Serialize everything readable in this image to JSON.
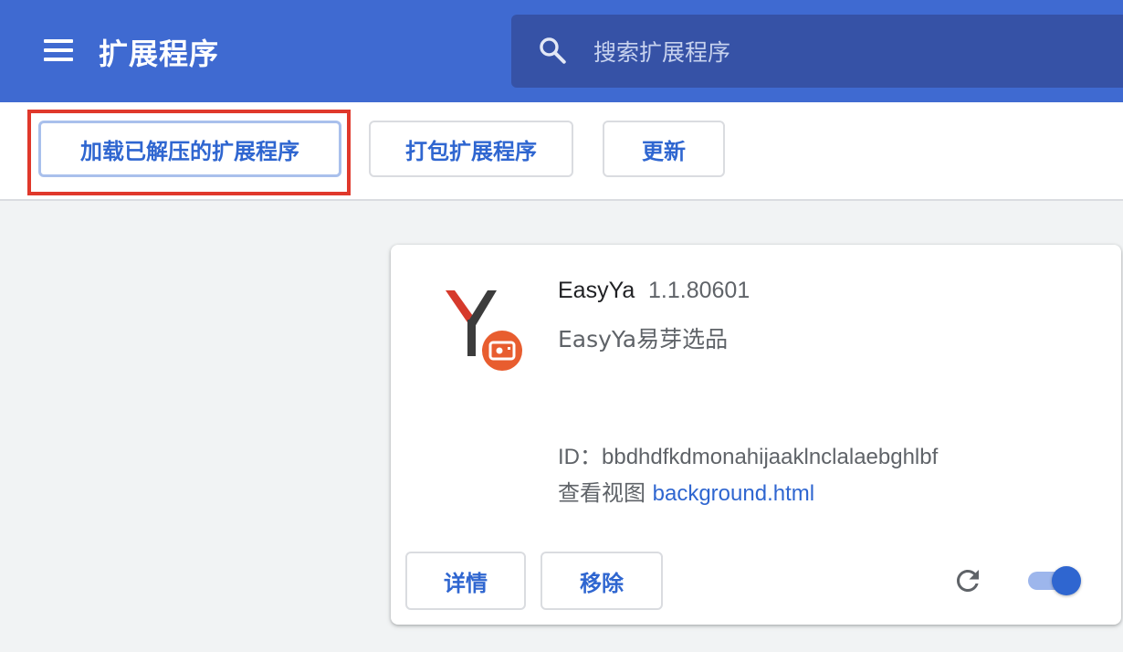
{
  "header": {
    "title": "扩展程序",
    "search_placeholder": "搜索扩展程序"
  },
  "toolbar": {
    "load_unpacked_label": "加载已解压的扩展程序",
    "pack_label": "打包扩展程序",
    "update_label": "更新"
  },
  "extension": {
    "name": "EasyYa",
    "version": "1.1.80601",
    "description": "EasyYa易芽选品",
    "id_label": "ID：",
    "id_value": "bbdhdfkdmonahijaaklnclalaebghlbf",
    "view_label": "查看视图",
    "view_link": "background.html",
    "details_label": "详情",
    "remove_label": "移除",
    "enabled": true
  },
  "colors": {
    "header_bg": "#3f6ad1",
    "search_bg": "#3652a6",
    "accent": "#2f66d0",
    "highlight": "#e0382b"
  }
}
